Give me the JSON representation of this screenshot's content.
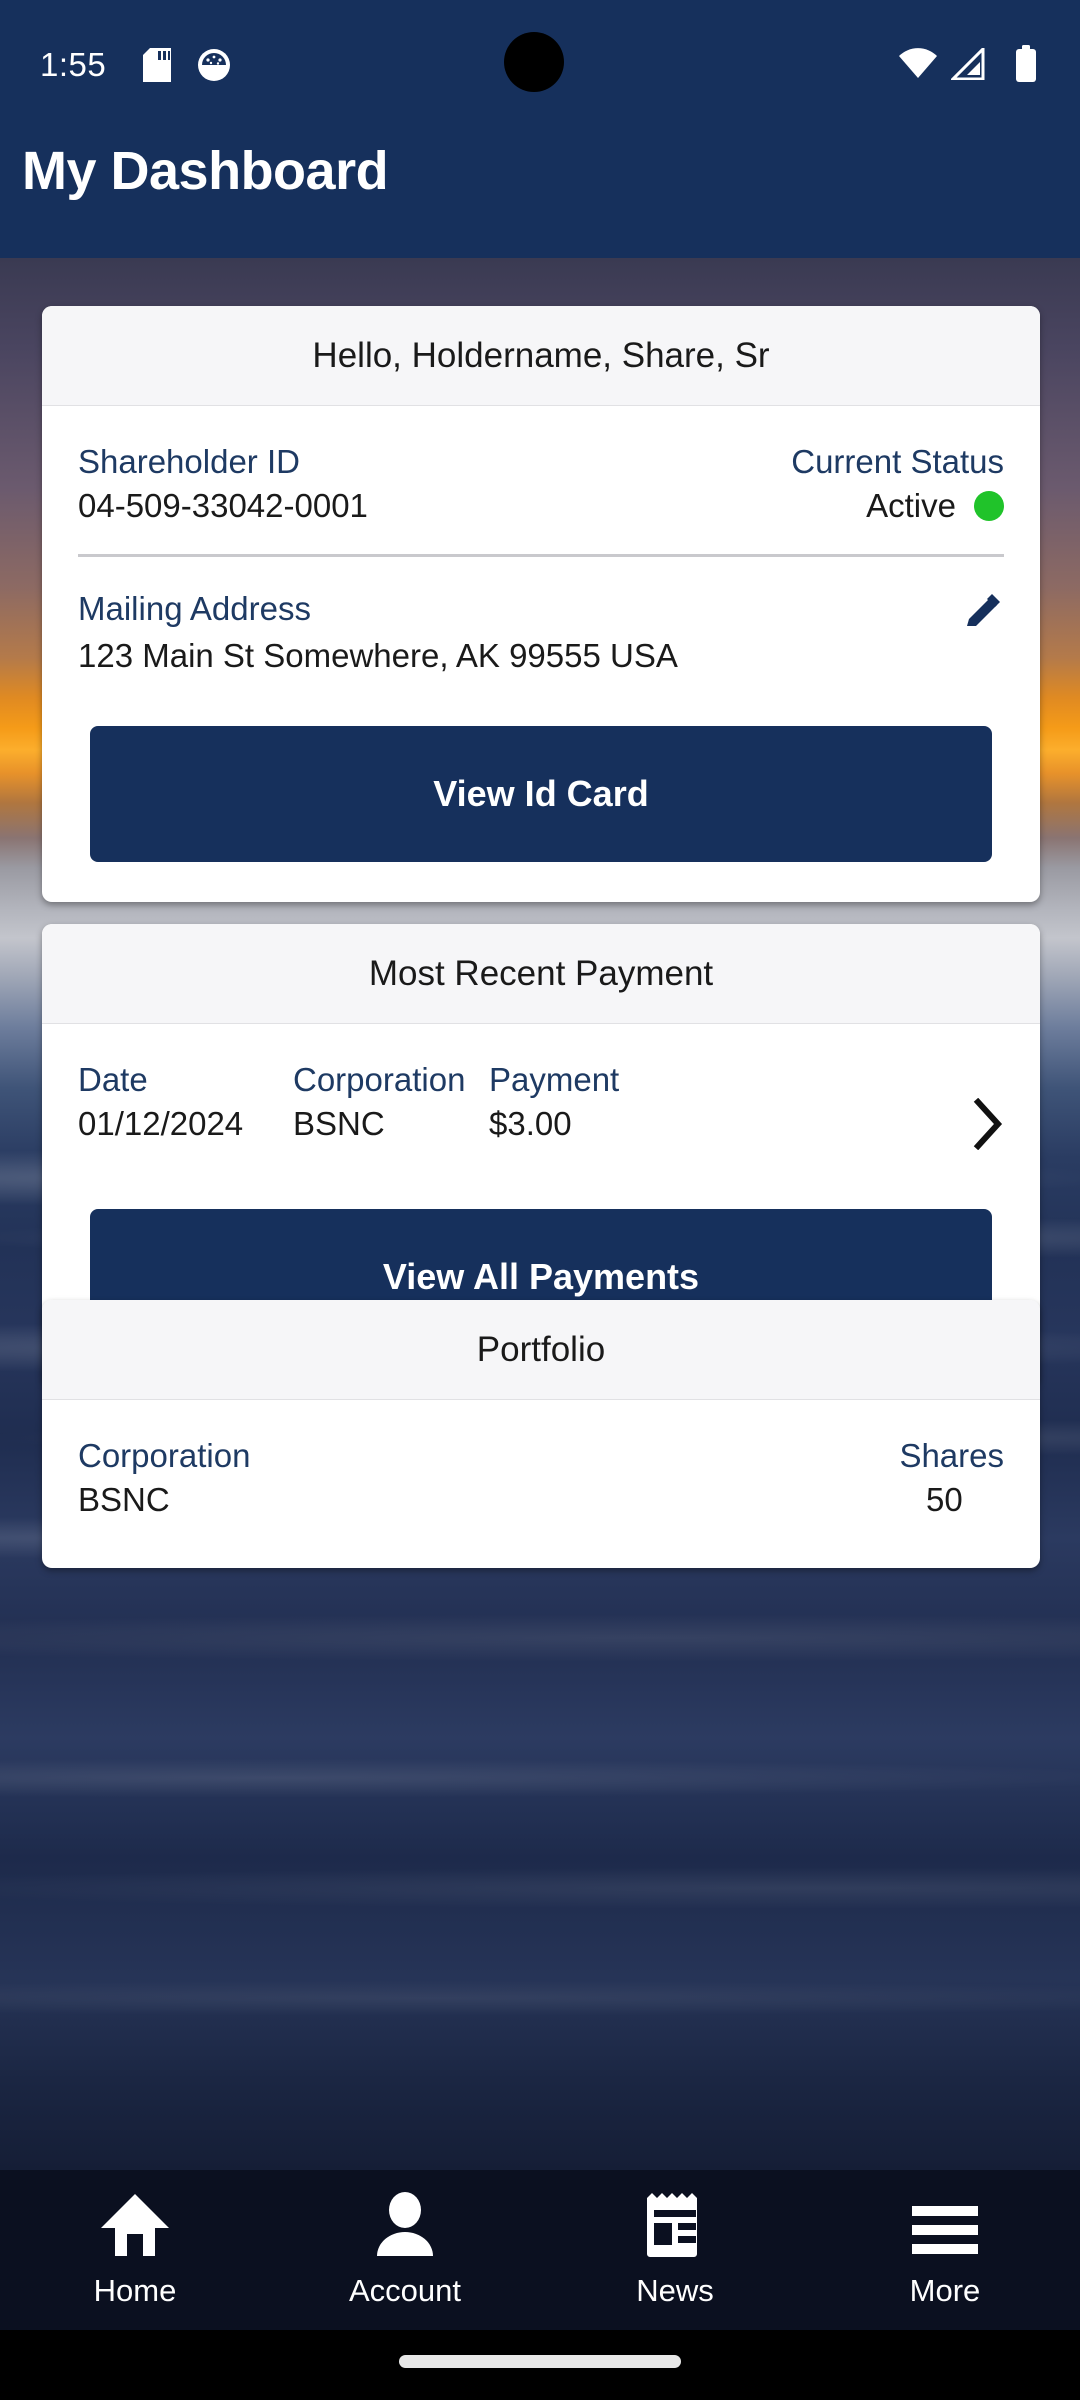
{
  "status_bar": {
    "time": "1:55",
    "icons_left": [
      "sd-card-icon",
      "night-mode-icon"
    ],
    "icons_right": [
      "wifi-icon",
      "cellular-signal-icon",
      "battery-icon"
    ]
  },
  "header": {
    "title": "My Dashboard",
    "background_color": "#16305c"
  },
  "account_card": {
    "greeting": "Hello, Holdername, Share, Sr",
    "shareholder_id_label": "Shareholder ID",
    "shareholder_id_value": "04-509-33042-0001",
    "current_status_label": "Current Status",
    "current_status_value": "Active",
    "status_color": "#20c32a",
    "mailing_address_label": "Mailing Address",
    "mailing_address_value": "123 Main St Somewhere, AK 99555 USA",
    "edit_icon": "pencil-icon",
    "view_id_card_button": "View Id Card"
  },
  "payment_card": {
    "title": "Most Recent Payment",
    "columns": [
      "Date",
      "Corporation",
      "Payment"
    ],
    "row": {
      "date": "01/12/2024",
      "corporation": "BSNC",
      "payment": "$3.00",
      "chevron": "chevron-right-icon"
    },
    "view_all_payments_button": "View All Payments"
  },
  "portfolio_card": {
    "title": "Portfolio",
    "columns": [
      "Corporation",
      "Shares"
    ],
    "rows": [
      {
        "corporation": "BSNC",
        "shares": "50"
      }
    ]
  },
  "bottom_nav": {
    "items": [
      {
        "label": "Home",
        "icon": "home-icon"
      },
      {
        "label": "Account",
        "icon": "person-icon"
      },
      {
        "label": "News",
        "icon": "newspaper-icon"
      },
      {
        "label": "More",
        "icon": "hamburger-menu-icon"
      }
    ]
  },
  "theme": {
    "primary": "#16305c",
    "label_text": "#1e3a63",
    "card_bg": "#ffffff",
    "card_header_bg": "#f6f6f8"
  }
}
